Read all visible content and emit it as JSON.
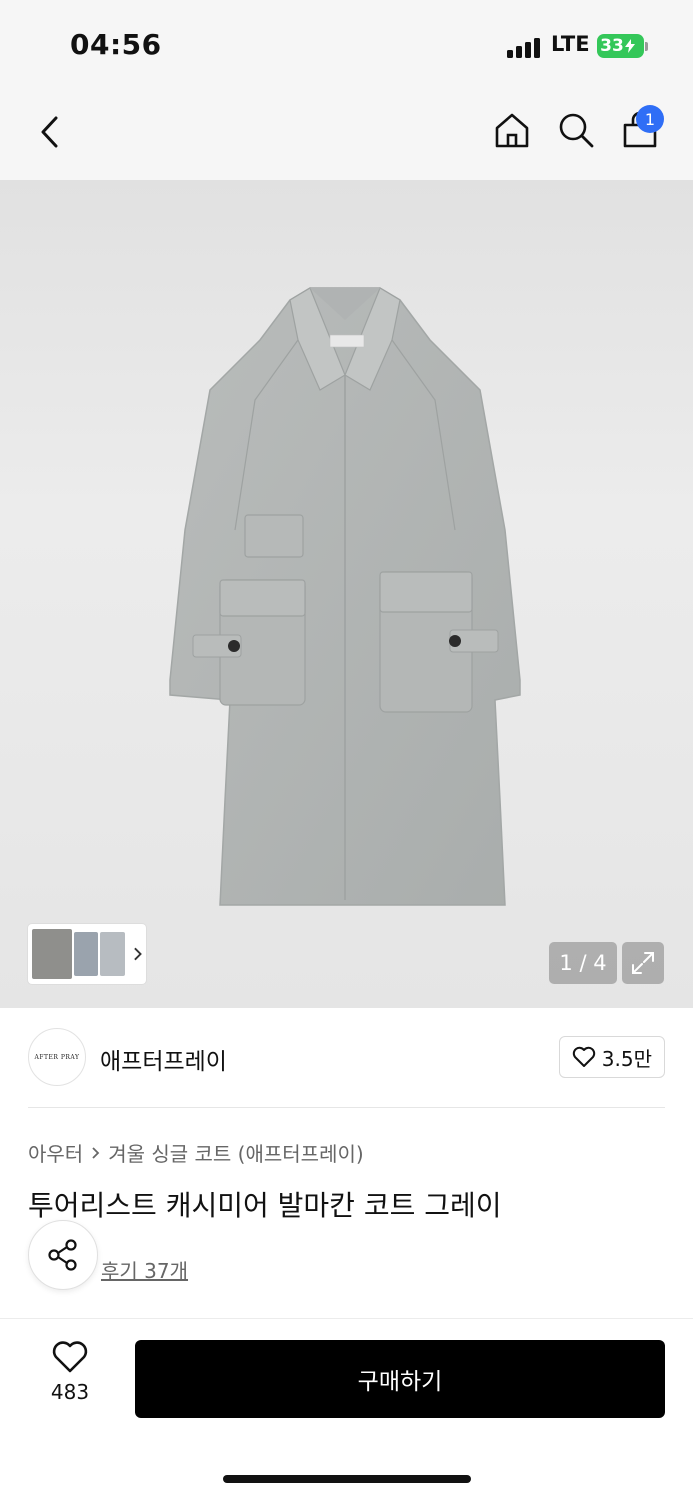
{
  "status_bar": {
    "time": "04:56",
    "network": "LTE",
    "battery": "33"
  },
  "nav": {
    "cart_count": "1",
    "icons": [
      "back-icon",
      "home-icon",
      "search-icon",
      "shopping-bag-icon"
    ]
  },
  "gallery": {
    "counter": "1 / 4",
    "thumbnail_colors": [
      "#8f8f8c",
      "#9aa3ad",
      "#b7bcc1"
    ]
  },
  "brand": {
    "logo_text": "AFTER PRAY",
    "name": "애프터프레이",
    "likes": "3.5만"
  },
  "product": {
    "breadcrumb": [
      "아우터",
      "겨울 싱글 코트 (애프터프레이)"
    ],
    "title": "투어리스트 캐시미어 발마칸 코트 그레이",
    "reviews": "후기 37개"
  },
  "bottom_bar": {
    "wish_count": "483",
    "buy_label": "구매하기"
  },
  "colors": {
    "badge": "#2f6ef6",
    "battery": "#34c759",
    "buy_button": "#000000"
  }
}
